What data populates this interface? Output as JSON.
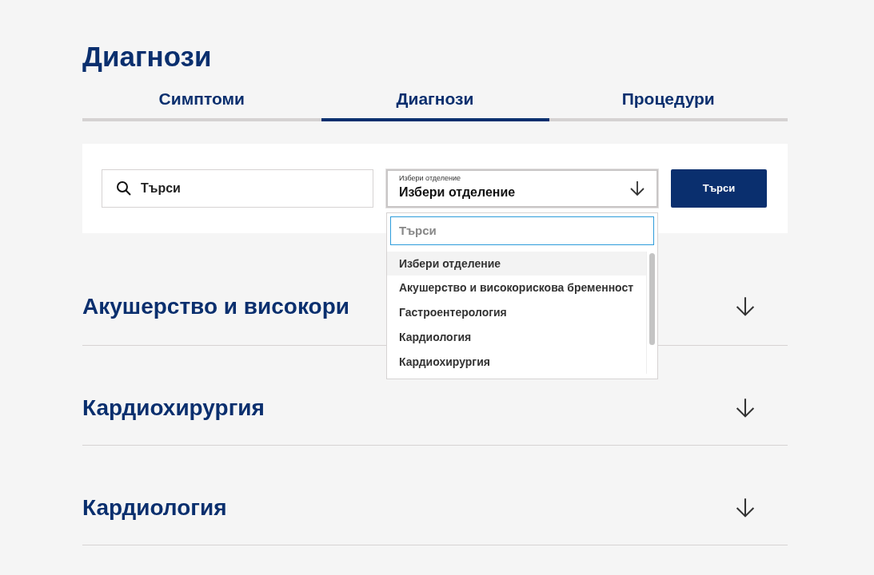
{
  "page_title": "Диагнози",
  "tabs": [
    {
      "label": "Симптоми",
      "selected": false
    },
    {
      "label": "Диагнози",
      "selected": true
    },
    {
      "label": "Процедури",
      "selected": false
    }
  ],
  "filters": {
    "search": {
      "placeholder": "Търси"
    },
    "department_select": {
      "floating_label": "Избери отделение",
      "value": "Избери отделение",
      "expanded": true
    },
    "search_button": "Търси"
  },
  "dropdown": {
    "search": {
      "placeholder": "Търси"
    },
    "options": [
      {
        "label": "Избери отделение",
        "selected": true
      },
      {
        "label": "Акушерство и високорискова бременност",
        "selected": false
      },
      {
        "label": "Гастроентерология",
        "selected": false
      },
      {
        "label": "Кардиология",
        "selected": false
      },
      {
        "label": "Кардиохирургия",
        "selected": false
      }
    ]
  },
  "accordion": [
    {
      "title": "Акушерство и високори",
      "expanded": false
    },
    {
      "title": "Кардиохирургия",
      "expanded": false
    },
    {
      "title": "Кардиология",
      "expanded": false
    }
  ]
}
